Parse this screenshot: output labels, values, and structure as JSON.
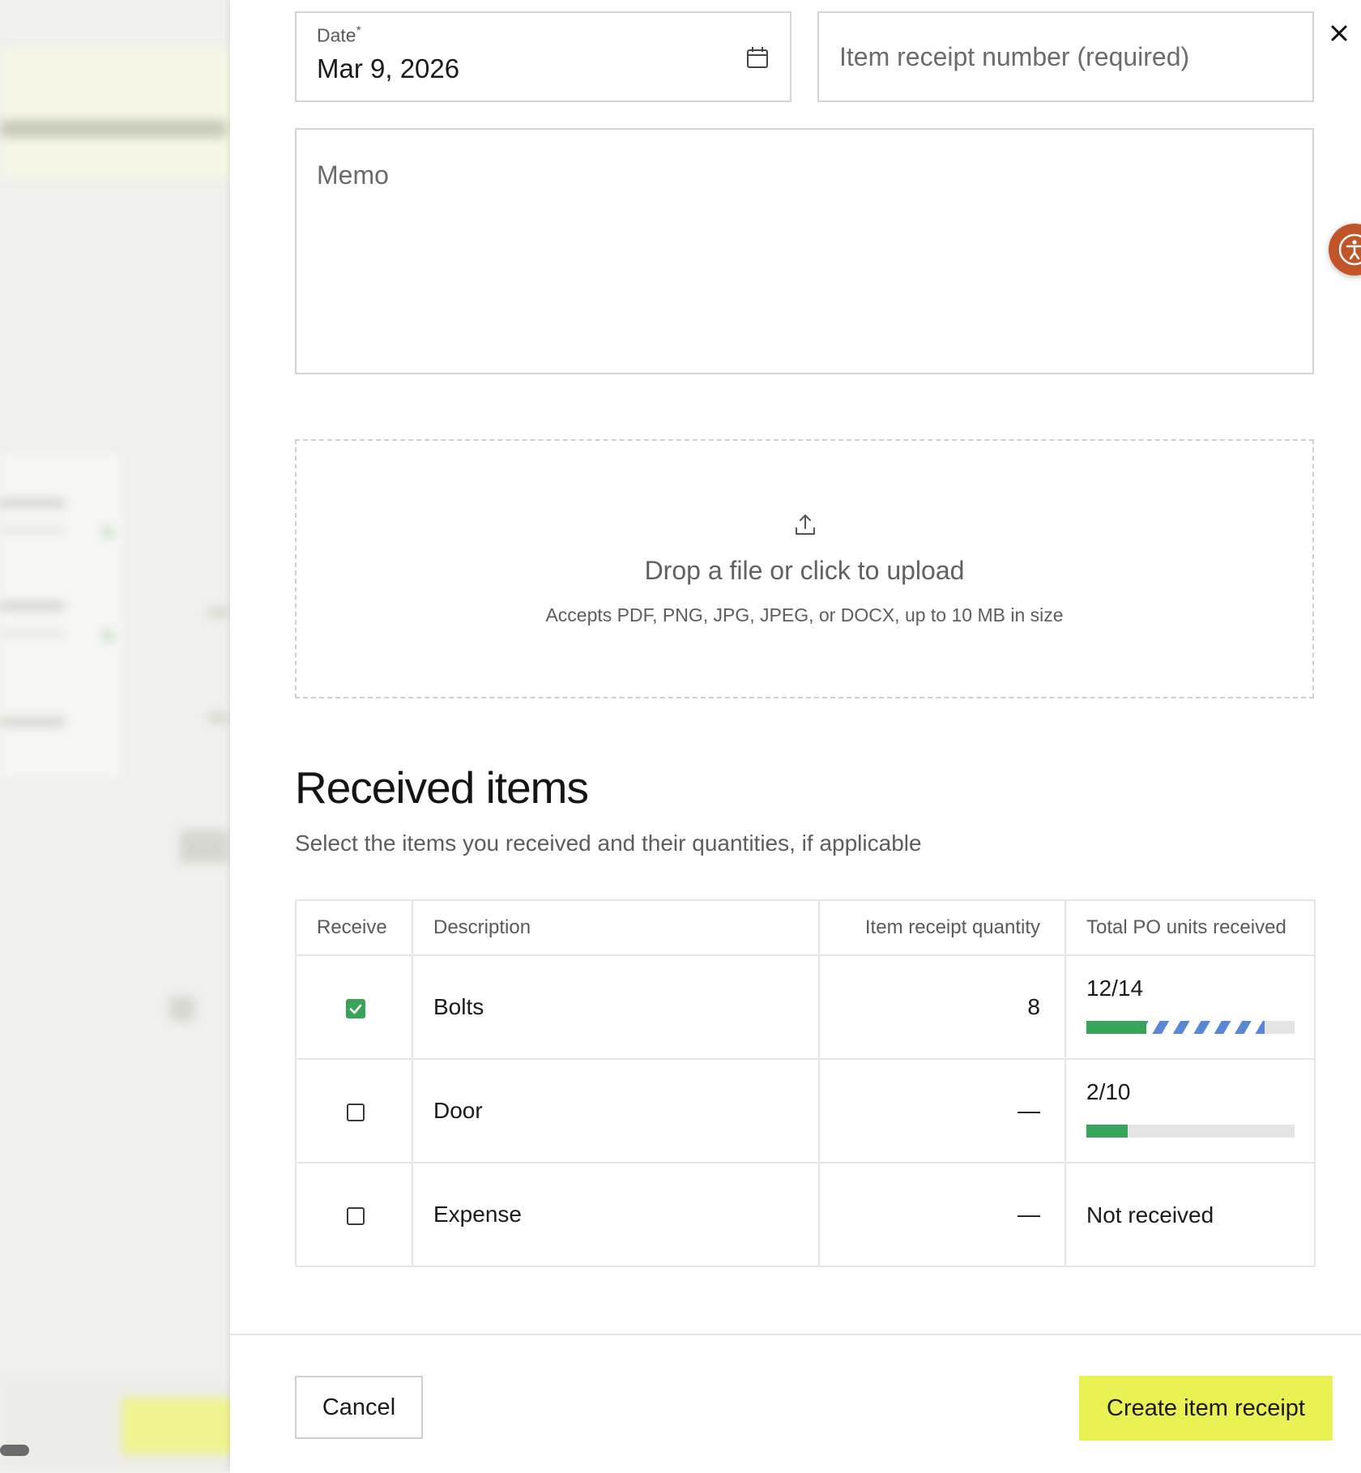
{
  "form": {
    "date": {
      "label": "Date",
      "required_mark": "*",
      "value": "Mar 9, 2026"
    },
    "receipt_number": {
      "placeholder": "Item receipt number (required)"
    },
    "memo": {
      "placeholder": "Memo"
    }
  },
  "upload": {
    "title": "Drop a file or click to upload",
    "subtitle": "Accepts PDF, PNG, JPG, JPEG, or DOCX, up to 10 MB in size"
  },
  "received_items": {
    "title": "Received items",
    "subtitle": "Select the items you received and their quantities, if applicable",
    "columns": [
      "Receive",
      "Description",
      "Item receipt quantity",
      "Total PO units received"
    ],
    "rows": [
      {
        "checked": true,
        "description": "Bolts",
        "quantity": "8",
        "units": "12/14",
        "received_fraction": 0.286,
        "pending_fraction": 0.571
      },
      {
        "checked": false,
        "description": "Door",
        "quantity": "—",
        "units": "2/10",
        "received_fraction": 0.2,
        "pending_fraction": 0
      },
      {
        "checked": false,
        "description": "Expense",
        "quantity": "—",
        "units": "Not received"
      }
    ]
  },
  "footer": {
    "cancel_label": "Cancel",
    "create_label": "Create item receipt"
  },
  "icons": {
    "close": "close-icon",
    "calendar": "calendar-icon",
    "upload": "upload-icon",
    "accessibility": "accessibility-icon",
    "checkmark": "checkmark-icon"
  },
  "colors": {
    "accent_button": "#e9f252",
    "received_bar": "#3aa35a",
    "pending_bar": "#5a86d6",
    "accessibility_button": "#c2542a"
  }
}
